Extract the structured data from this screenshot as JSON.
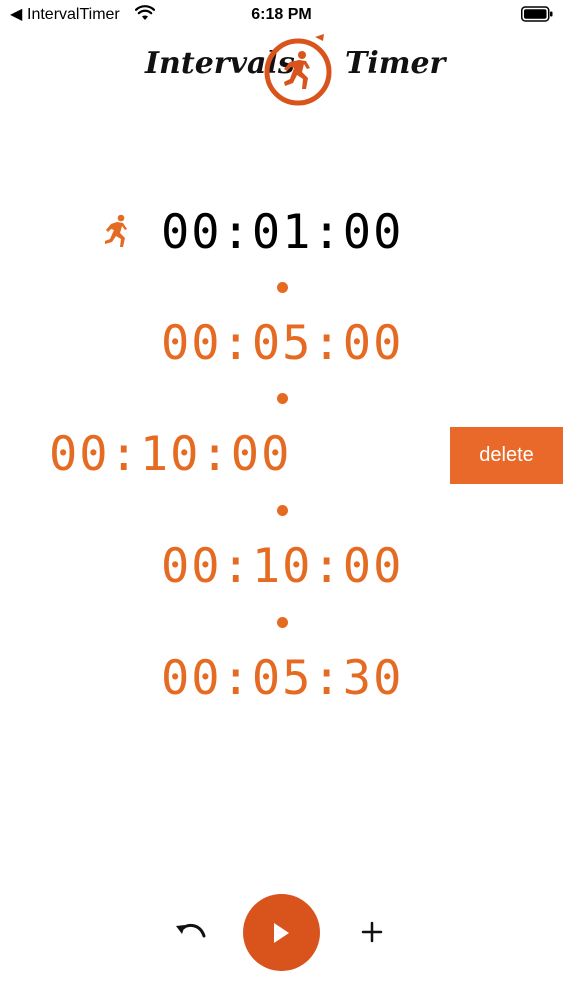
{
  "status_bar": {
    "back_glyph": "◀",
    "app_name": "IntervalTimer",
    "time": "6:18 PM",
    "icons": [
      "wifi-icon",
      "battery-icon"
    ]
  },
  "logo": {
    "left_word": "Intervals",
    "right_word": "Timer",
    "emblem": "stopwatch-runner-icon"
  },
  "intervals": [
    {
      "time": "00:01:00",
      "state": "active",
      "icon": "runner-icon"
    },
    {
      "time": "00:05:00",
      "state": "inactive"
    },
    {
      "time": "00:10:00",
      "state": "inactive",
      "swiped": true
    },
    {
      "time": "00:10:00",
      "state": "inactive"
    },
    {
      "time": "00:05:30",
      "state": "inactive"
    }
  ],
  "row_action": {
    "label": "delete"
  },
  "toolbar": {
    "undo_icon": "undo-icon",
    "play_icon": "play-icon",
    "add_icon": "plus-icon"
  },
  "colors": {
    "accent": "#e56a22",
    "play_button": "#d9541c",
    "delete_button": "#e8692a",
    "active_text": "#000000",
    "background": "#ffffff"
  }
}
